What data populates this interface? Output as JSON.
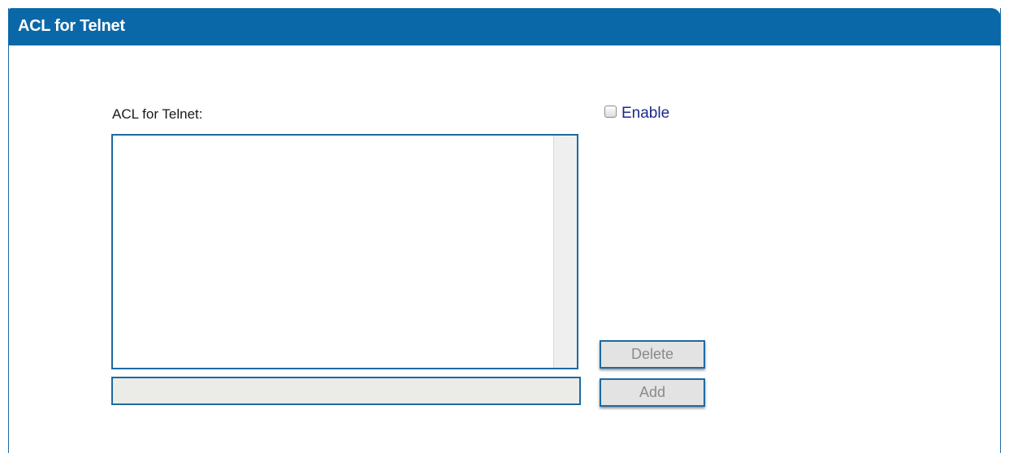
{
  "panel": {
    "title": "ACL for Telnet"
  },
  "form": {
    "acl_label": "ACL for Telnet:",
    "enable_label": "Enable",
    "enable_checked": false,
    "acl_entries": [],
    "entry_value": "",
    "delete_label": "Delete",
    "add_label": "Add"
  },
  "colors": {
    "header_bg": "#0b68a8",
    "border": "#1e6aa3",
    "enable_text": "#1a2a8a",
    "button_disabled_text": "#8a8a8a"
  }
}
